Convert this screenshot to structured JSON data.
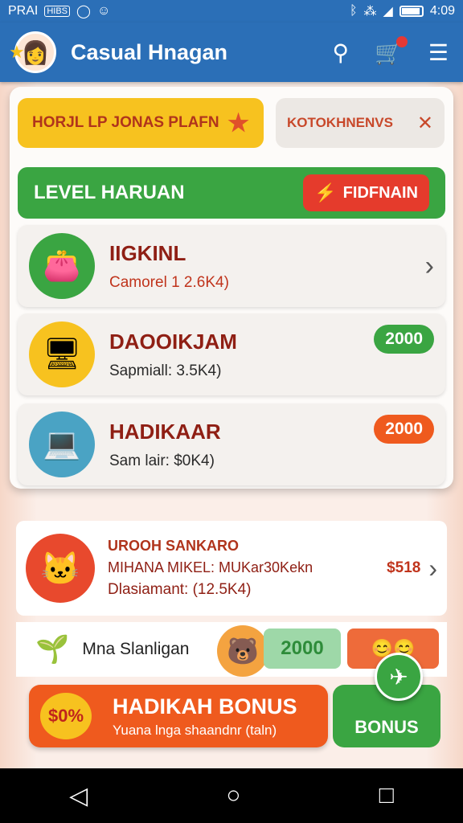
{
  "status_bar": {
    "left_text": "PRAI",
    "box_text": "HIBS",
    "time": "4:09"
  },
  "app_bar": {
    "title": "Casual Hnagan"
  },
  "chips": {
    "yellow_label": "HORJL LP JONAS PLAFN",
    "grey_label": "KOTOKHNENVS"
  },
  "level": {
    "title": "LEVEL HARUAN",
    "button_label": "FIDFNAIN"
  },
  "items": [
    {
      "title": "IIGKINL",
      "subtitle": "Camorel 1 2.6K4)",
      "action": "chevron"
    },
    {
      "title": "DAOOIKJAM",
      "subtitle": "Sapmiall: 3.5K4)",
      "points": "2000",
      "badge_color": "#3aa542"
    },
    {
      "title": "HADIKAAR",
      "subtitle": "Sam lair: $0K4)",
      "points": "2000",
      "badge_color": "#ef5a1e"
    }
  ],
  "promo_card": {
    "line1": "UROOH SANKARO",
    "line2": "MIHANA MIKEL: MUKar30Kekn",
    "line3": "Dlasiamant: (12.5K4)",
    "price": "$518"
  },
  "row": {
    "label": "Mna Slanligan",
    "green_value": "2000"
  },
  "bonus": {
    "percent": "$0%",
    "title": "HADIKAH BONUS",
    "subtitle": "Yuana lnga shaandnr (taln)",
    "button": "BONUS"
  }
}
